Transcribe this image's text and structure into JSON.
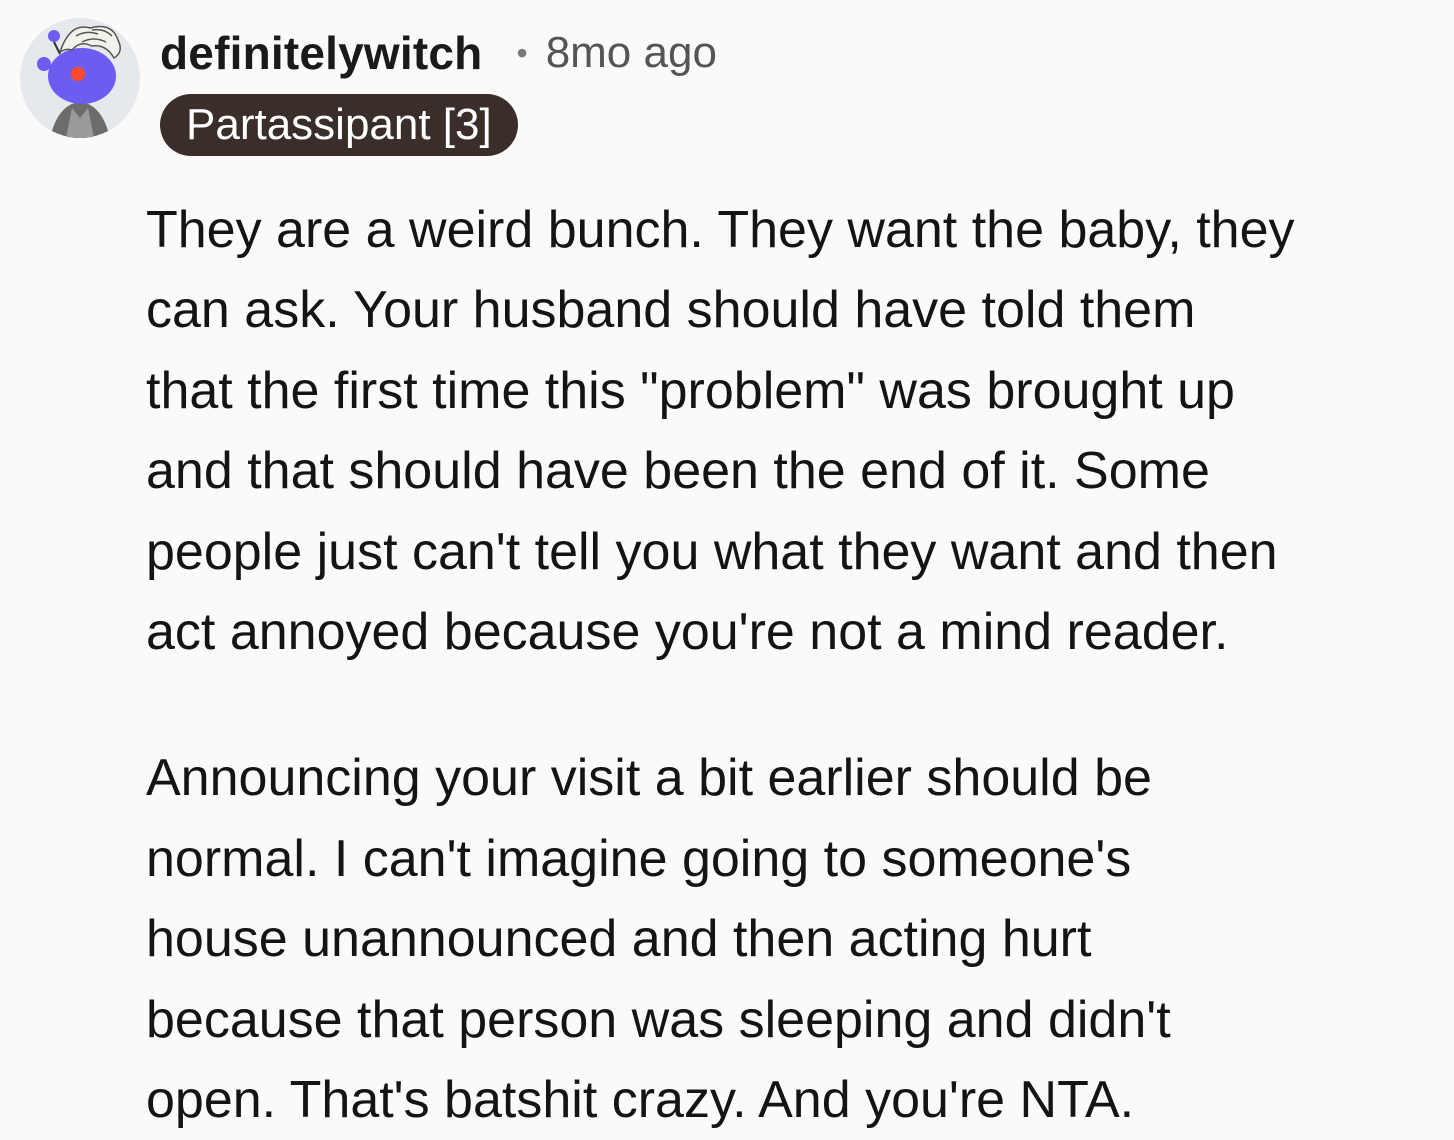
{
  "comment": {
    "username": "definitelywitch",
    "separator": "•",
    "timestamp": "8mo ago",
    "flair": "Partassipant [3]",
    "avatar_icon": "snoo-avatar-icon",
    "paragraphs": [
      [
        "They are a weird bunch. They want the baby, they",
        "can ask. Your husband should have told them",
        "that the first time this \"problem\" was brought up",
        "and that should have been the end of it. Some",
        "people just can't tell you what they want and then",
        "act annoyed because you're not a mind reader."
      ],
      [
        "Announcing your visit a bit earlier should be",
        "normal. I can't imagine going to someone's",
        "house unannounced and then acting hurt",
        "because that person was sleeping and didn't",
        "open. That's batshit crazy. And you're NTA."
      ]
    ]
  },
  "colors": {
    "background": "#fbfaf9",
    "flair_bg": "#3a2e2b",
    "avatar_bg": "#e5e9ee",
    "snoo_body": "#6c5cf0"
  }
}
